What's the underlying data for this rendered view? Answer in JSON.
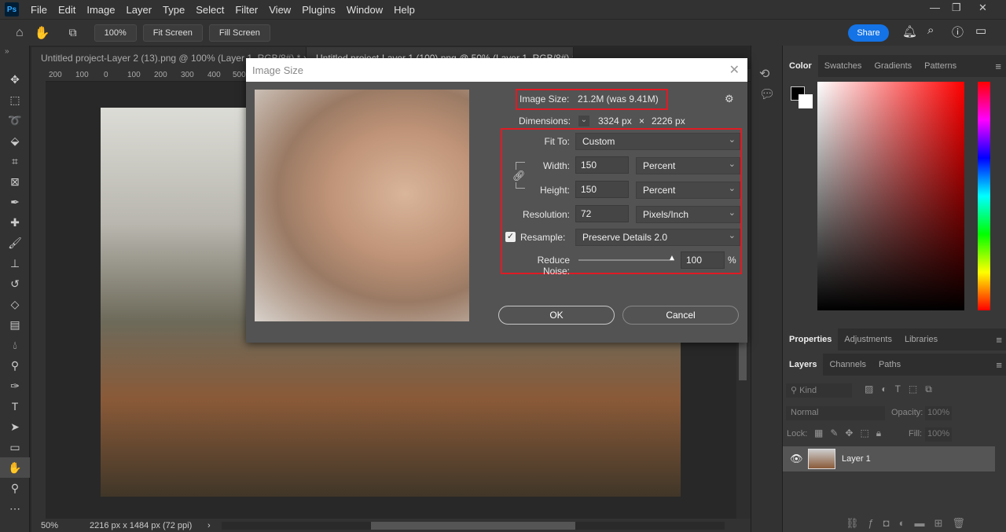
{
  "app": {
    "logo": "Ps"
  },
  "menu": [
    "File",
    "Edit",
    "Image",
    "Layer",
    "Type",
    "Select",
    "Filter",
    "View",
    "Plugins",
    "Window",
    "Help"
  ],
  "options": {
    "zoom_btn": "100%",
    "fit_screen": "Fit Screen",
    "fill_screen": "Fill Screen",
    "share": "Share"
  },
  "tabs": [
    {
      "label": "Untitled project-Layer 2 (13).png @ 100% (Layer 1, RGB/8#) *  ×"
    },
    {
      "label": "Untitled project-Layer 1 (100).png @ 50% (Layer 1, RGB/8#)  ×"
    }
  ],
  "ruler": [
    "200",
    "100",
    "0",
    "100",
    "200",
    "300",
    "400",
    "500"
  ],
  "status": {
    "zoom": "50%",
    "doc_info": "2216 px x 1484 px (72 ppi)",
    "arrow": "›"
  },
  "dialog": {
    "title": "Image Size",
    "image_size_label": "Image Size:",
    "image_size_value": "21.2M (was 9.41M)",
    "dimensions_label": "Dimensions:",
    "dim_w": "3324 px",
    "dim_x": "×",
    "dim_h": "2226 px",
    "fit_to_label": "Fit To:",
    "fit_to": "Custom",
    "width_label": "Width:",
    "width": "150",
    "width_unit": "Percent",
    "height_label": "Height:",
    "height": "150",
    "height_unit": "Percent",
    "resolution_label": "Resolution:",
    "resolution": "72",
    "resolution_unit": "Pixels/Inch",
    "resample_label": "Resample:",
    "resample_checked": true,
    "resample": "Preserve Details 2.0",
    "noise_label": "Reduce Noise:",
    "noise": "100",
    "noise_unit": "%",
    "ok": "OK",
    "cancel": "Cancel"
  },
  "panels": {
    "color_tabs": [
      "Color",
      "Swatches",
      "Gradients",
      "Patterns"
    ],
    "prop_tabs": [
      "Properties",
      "Adjustments",
      "Libraries"
    ],
    "layer_tabs": [
      "Layers",
      "Channels",
      "Paths"
    ],
    "kind": "Kind",
    "blend": "Normal",
    "opacity_label": "Opacity:",
    "opacity": "100%",
    "lock_label": "Lock:",
    "fill_label": "Fill:",
    "fill": "100%",
    "layers": [
      {
        "name": "Layer 1",
        "visible": true
      }
    ]
  },
  "colors": {
    "accent": "#1473e6",
    "highlight": "#e01b24"
  }
}
